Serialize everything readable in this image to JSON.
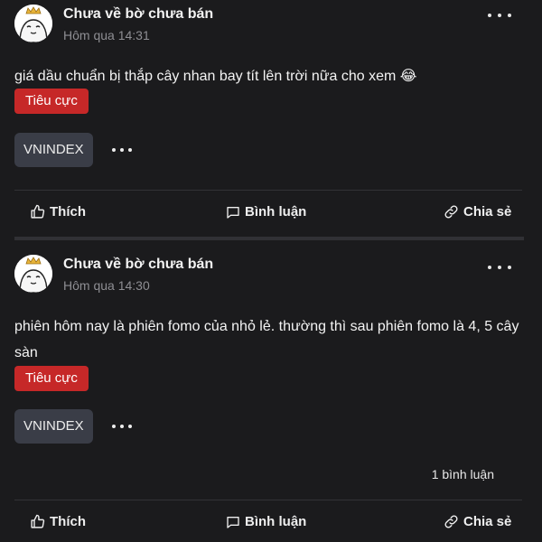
{
  "posts": [
    {
      "author": "Chưa về bờ chưa bán",
      "time": "Hôm qua 14:31",
      "content": "giá dầu chuẩn bị thắp cây nhan bay tít lên trời nữa cho xem 😂",
      "sentiment": "Tiêu cực",
      "ticker": "VNINDEX",
      "comment_count": "",
      "actions": {
        "like": "Thích",
        "comment": "Bình luận",
        "share": "Chia sẻ"
      }
    },
    {
      "author": "Chưa về bờ chưa bán",
      "time": "Hôm qua 14:30",
      "content": "phiên hôm nay là phiên fomo của nhỏ lẻ. thường thì sau phiên fomo là 4, 5 cây sàn",
      "sentiment": "Tiêu cực",
      "ticker": "VNINDEX",
      "comment_count": "1 bình luận",
      "actions": {
        "like": "Thích",
        "comment": "Bình luận",
        "share": "Chia sẻ"
      }
    }
  ],
  "colors": {
    "background": "#1b1b1d",
    "negative_badge": "#c62828",
    "ticker_chip": "#3a3d47",
    "muted_text": "#8e8e93"
  },
  "icons": [
    "avatar-cartoon-crown",
    "more-horizontal-icon",
    "thumbs-up-icon",
    "chat-bubble-icon",
    "link-icon"
  ]
}
